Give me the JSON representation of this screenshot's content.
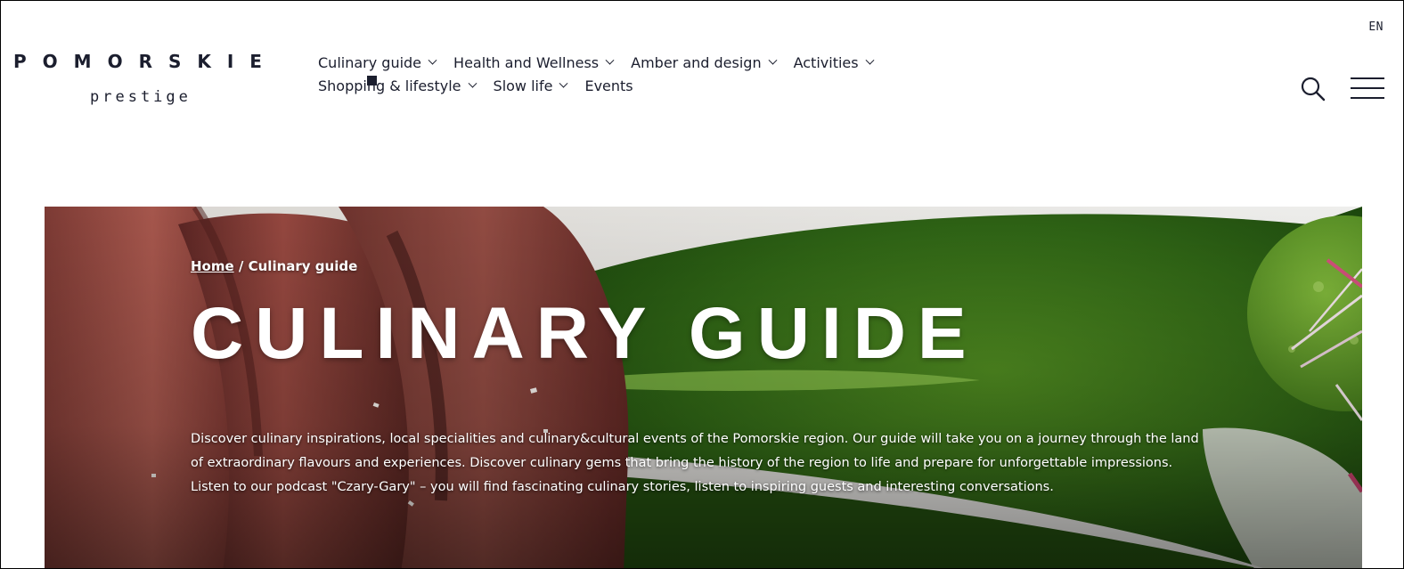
{
  "header": {
    "language": "EN",
    "logo": {
      "line1": "POMORSKIE",
      "line2": "prestige"
    }
  },
  "nav": {
    "row1": [
      {
        "label": "Culinary guide",
        "has_dropdown": true
      },
      {
        "label": "Health and Wellness",
        "has_dropdown": true
      },
      {
        "label": "Amber and design",
        "has_dropdown": true
      },
      {
        "label": "Activities",
        "has_dropdown": true
      }
    ],
    "row2": [
      {
        "label": "Shopping & lifestyle",
        "has_dropdown": true
      },
      {
        "label": "Slow life",
        "has_dropdown": true
      },
      {
        "label": "Events",
        "has_dropdown": false
      }
    ],
    "active": "Culinary guide"
  },
  "controls": {
    "search_icon": "search-icon",
    "menu_icon": "hamburger-menu-icon"
  },
  "hero": {
    "breadcrumb": {
      "home": "Home",
      "separator": " / ",
      "current": "Culinary guide"
    },
    "title": "CULINARY GUIDE",
    "description": "Discover culinary inspirations, local specialities and culinary&cultural events of the Pomorskie region. Our guide will take you on a journey through the land of extraordinary flavours and experiences. Discover culinary gems that bring the history of the region to life and prepare for unforgettable impressions. Listen to our podcast \"Czary-Gary\" – you will find fascinating culinary stories, listen to inspiring guests and interesting conversations."
  },
  "colors": {
    "text_dark": "#1b1e2e",
    "hero_green": "#2f5d1a",
    "meat_red": "#9c4a43"
  }
}
